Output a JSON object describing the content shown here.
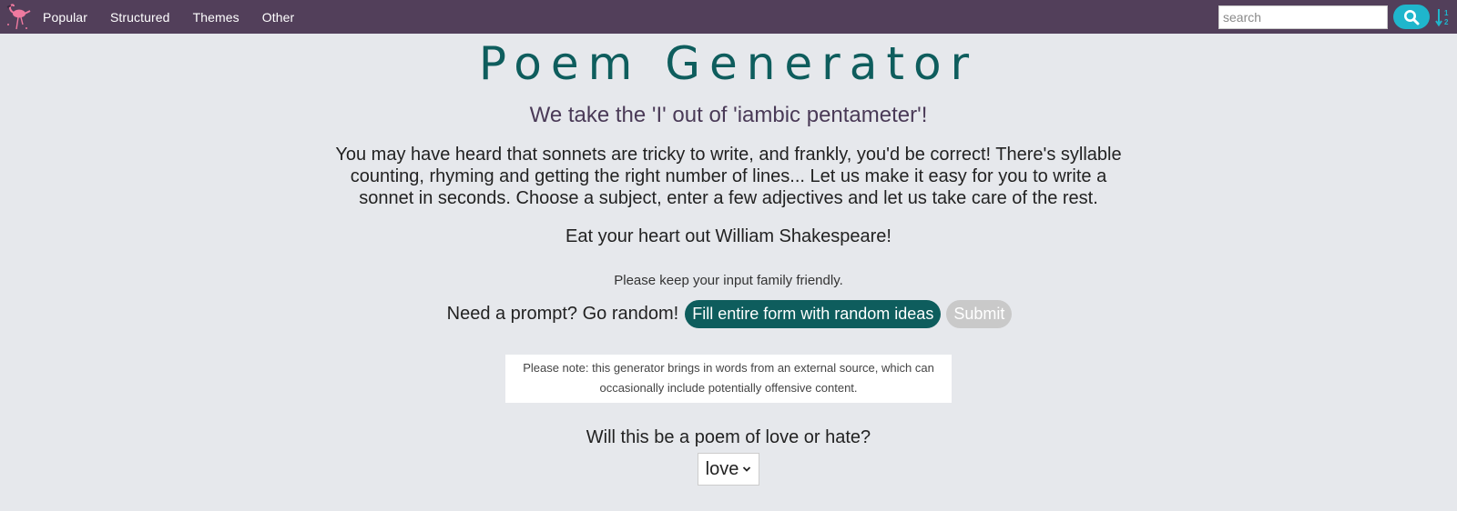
{
  "nav": {
    "links": [
      "Popular",
      "Structured",
      "Themes",
      "Other"
    ],
    "search_placeholder": "search",
    "search_value": "",
    "icons": {
      "logo": "flamingo-logo-icon",
      "search": "search-icon",
      "sort": "sort-numeric-icon"
    }
  },
  "main": {
    "title": "Poem Generator",
    "subtitle": "We take the 'I' out of 'iambic pentameter'!",
    "intro": "You may have heard that sonnets are tricky to write, and frankly, you'd be correct! There's syllable counting, rhyming and getting the right number of lines... Let us make it easy for you to write a sonnet in seconds. Choose a subject, enter a few adjectives and let us take care of the rest.",
    "tagline": "Eat your heart out William Shakespeare!",
    "family_note": "Please keep your input family friendly.",
    "prompt_label": "Need a prompt? Go random!",
    "random_button": "Fill entire form with random ideas",
    "submit_button": "Submit",
    "warning": "Please note: this generator brings in words from an external source, which can occasionally include potentially offensive content.",
    "question": "Will this be a poem of love or hate?",
    "select_value": "love"
  },
  "colors": {
    "navbar": "#523f5a",
    "title": "#0e5d5d",
    "subtitle": "#4a3a57",
    "accent_button": "#0e5d5d",
    "search_button": "#1fb6cc",
    "submit_disabled": "#c9c9c9",
    "page_background": "#e6e8ec"
  }
}
